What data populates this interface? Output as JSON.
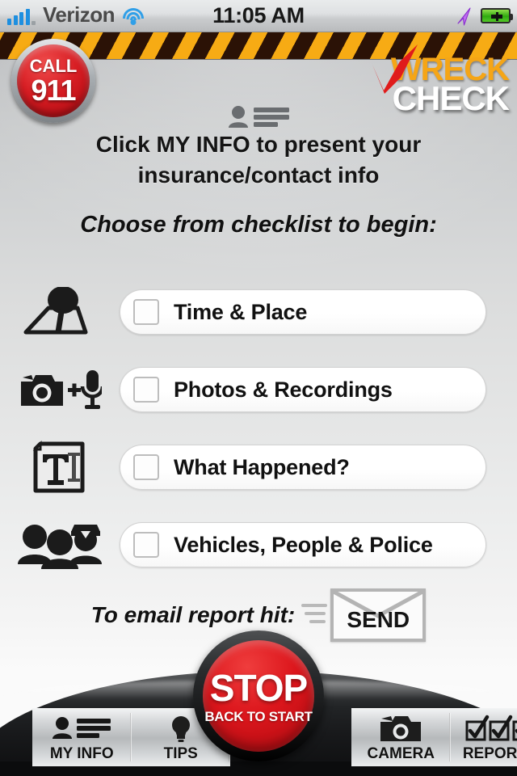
{
  "status_bar": {
    "signal_icon": "signal-bars-icon",
    "carrier": "Verizon",
    "wifi_icon": "wifi-icon",
    "time": "11:05 AM",
    "location_icon": "location-arrow-icon",
    "battery_icon": "battery-charging-icon"
  },
  "header": {
    "call_button": {
      "line1": "CALL",
      "line2": "911"
    },
    "logo": {
      "word1": "WRECK",
      "word2": "CHECK",
      "check_icon": "red-checkmark-icon",
      "word1_color": "#f5a516",
      "word2_color": "#ffffff"
    },
    "hazard_stripe": {
      "color_a": "#f7ab14",
      "color_b": "#2b1206"
    }
  },
  "prompt": {
    "icon": "my-info-person-icon",
    "line1": "Click MY INFO to present your",
    "line2": "insurance/contact info"
  },
  "choose_heading": "Choose from checklist to begin:",
  "checklist": {
    "items": [
      {
        "icon": "map-location-pin-icon",
        "label": "Time & Place",
        "checked": false
      },
      {
        "icon": "camera-microphone-icon",
        "label": "Photos & Recordings",
        "checked": false
      },
      {
        "icon": "document-text-icon",
        "label": "What Happened?",
        "checked": false
      },
      {
        "icon": "people-police-icon",
        "label": "Vehicles, People & Police",
        "checked": false
      }
    ]
  },
  "send": {
    "text": "To email report hit:",
    "button_label": "SEND",
    "envelope_icon": "envelope-icon",
    "speed_lines_icon": "motion-lines-icon"
  },
  "stop_button": {
    "title": "STOP",
    "subtitle": "BACK TO START",
    "color": "#dc161c"
  },
  "tab_bar": {
    "items": [
      {
        "icon": "my-info-person-icon",
        "label": "MY INFO"
      },
      {
        "icon": "lightbulb-icon",
        "label": "TIPS"
      },
      {
        "icon": "camera-icon",
        "label": "CAMERA"
      },
      {
        "icon": "checkmark-boxes-icon",
        "label": "REPORTS"
      }
    ]
  }
}
